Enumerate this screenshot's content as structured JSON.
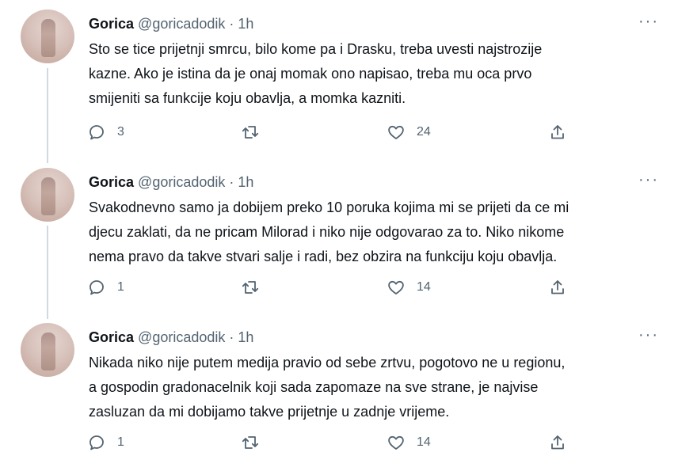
{
  "tweets": [
    {
      "name": "Gorica",
      "handle": "@goricadodik",
      "dot": "·",
      "time": "1h",
      "text": "Sto se tice prijetnji smrcu, bilo kome pa i Drasku, treba uvesti najstrozije\nkazne. Ako je istina da je onaj momak ono napisao, treba mu oca prvo\nsmijeniti sa funkcije koju obavlja, a momka kazniti.",
      "replies": "3",
      "retweets": "",
      "likes": "24"
    },
    {
      "name": "Gorica",
      "handle": "@goricadodik",
      "dot": "·",
      "time": "1h",
      "text": "Svakodnevno samo ja dobijem preko 10 poruka kojima mi se prijeti da ce mi\ndjecu zaklati, da ne pricam Milorad i niko nije odgovarao za to. Niko nikome\nnema pravo da takve stvari salje i radi, bez obzira na funkciju koju obavlja.",
      "replies": "1",
      "retweets": "",
      "likes": "14"
    },
    {
      "name": "Gorica",
      "handle": "@goricadodik",
      "dot": "·",
      "time": "1h",
      "text": "Nikada niko nije putem medija pravio od sebe zrtvu, pogotovo ne u regionu,\na gospodin gradonacelnik koji sada zapomaze na sve strane, je najvise\nzasluzan da mi dobijamo takve prijetnje u zadnje vrijeme.",
      "replies": "1",
      "retweets": "",
      "likes": "14"
    }
  ],
  "icons": {
    "reply": "reply-icon",
    "retweet": "retweet-icon",
    "like": "like-icon",
    "share": "share-icon",
    "more": "more-icon"
  },
  "colors": {
    "text": "#0f1419",
    "secondary": "#536471",
    "thread_line": "#cfd9de"
  }
}
